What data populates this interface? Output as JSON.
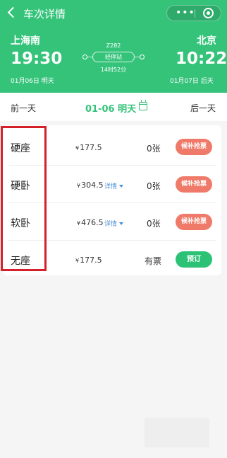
{
  "header": {
    "title": "车次详情",
    "capsule_more": "•••",
    "from_station": "上海南",
    "to_station": "北京",
    "depart_time": "19:30",
    "arrive_time": "10:22",
    "depart_date": "01月06日 明天",
    "arrive_date": "01月07日 后天",
    "train_no": "Z282",
    "stops_label": "经停站",
    "duration": "14时52分"
  },
  "datebar": {
    "prev": "前一天",
    "current": "01-06 明天",
    "next": "后一天"
  },
  "seats": [
    {
      "type": "硬座",
      "currency": "¥",
      "price": "177.5",
      "detail": "",
      "tickets": "0张",
      "action": "候补抢票"
    },
    {
      "type": "硬卧",
      "currency": "¥",
      "price": "304.5",
      "detail": "详情",
      "tickets": "0张",
      "action": "候补抢票"
    },
    {
      "type": "软卧",
      "currency": "¥",
      "price": "476.5",
      "detail": "详情",
      "tickets": "0张",
      "action": "候补抢票"
    },
    {
      "type": "无座",
      "currency": "¥",
      "price": "177.5",
      "detail": "",
      "tickets": "有票",
      "action": "预订"
    }
  ],
  "colors": {
    "brand_green": "#35c37a",
    "wait_btn": "#ef7a69",
    "book_btn": "#2cc275",
    "highlight_red": "#d5202a",
    "detail_blue": "#4a8fd9"
  },
  "icons": [
    "back-arrow-icon",
    "more-icon",
    "target-icon",
    "calendar-icon",
    "dropdown-triangle-icon"
  ]
}
